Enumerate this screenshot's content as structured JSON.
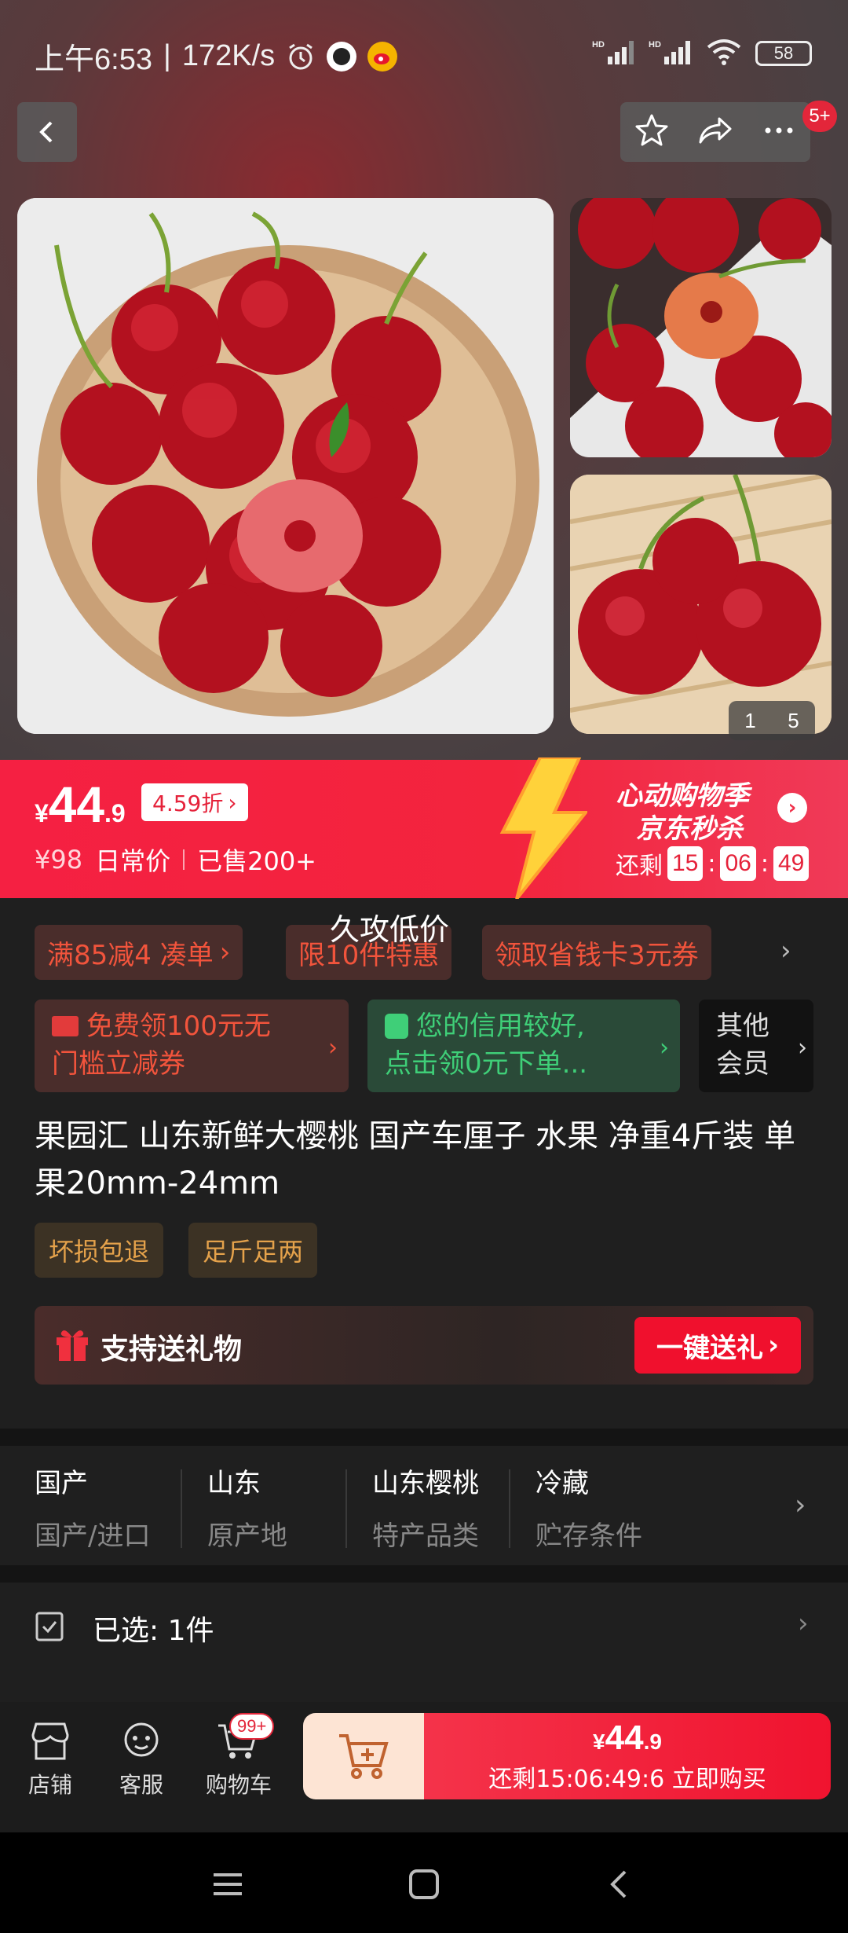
{
  "status_bar": {
    "time": "上午6:53",
    "speed": "172K/s",
    "battery": "58",
    "signal1": "HD",
    "signal2": "HD"
  },
  "header": {
    "cart_count_badge": "5+"
  },
  "gallery": {
    "current_page": "1",
    "total_pages": "5"
  },
  "price_banner": {
    "currency": "¥",
    "price_int": "44",
    "price_dec": ".9",
    "discount": "4.59折",
    "original_price": "¥98",
    "original_label": "日常价",
    "sold": "已售200+",
    "promo_title": "心动购物季",
    "promo_sub": "京东秒杀",
    "countdown_label": "还剩",
    "hh": "15",
    "mm": "06",
    "ss": "49"
  },
  "overlay_text": "久攻低价",
  "coupons": [
    {
      "label": "满85减4 凑单"
    },
    {
      "label": "限10件特惠"
    },
    {
      "label": "领取省钱卡3元券"
    }
  ],
  "membership": {
    "coupon_line1": "免费领100元无",
    "coupon_line2": "门槛立减券",
    "credit_line1": "您的信用较好,",
    "credit_line2": "点击领0元下单...",
    "other_line1": "其他",
    "other_line2": "会员"
  },
  "product": {
    "title": "果园汇 山东新鲜大樱桃 国产车厘子 水果 净重4斤装 单果20mm-24mm",
    "tags": [
      "坏损包退",
      "足斤足两"
    ]
  },
  "gift": {
    "label": "支持送礼物",
    "button": "一键送礼"
  },
  "attributes": [
    {
      "value": "国产",
      "key": "国产/进口"
    },
    {
      "value": "山东",
      "key": "原产地"
    },
    {
      "value": "山东樱桃",
      "key": "特产品类"
    },
    {
      "value": "冷藏",
      "key": "贮存条件"
    }
  ],
  "selected": {
    "text": "已选: 1件"
  },
  "bottom_bar": {
    "store": "店铺",
    "service": "客服",
    "cart": "购物车",
    "cart_badge": "99+",
    "buy_currency": "¥",
    "buy_int": "44",
    "buy_dec": ".9",
    "buy_sub": "还剩15:06:49:6 立即购买"
  },
  "colors": {
    "accent_red": "#f0102d",
    "coupon_text": "#f2543c",
    "credit_green": "#3fcf78",
    "tag_orange": "#e5a24b"
  }
}
